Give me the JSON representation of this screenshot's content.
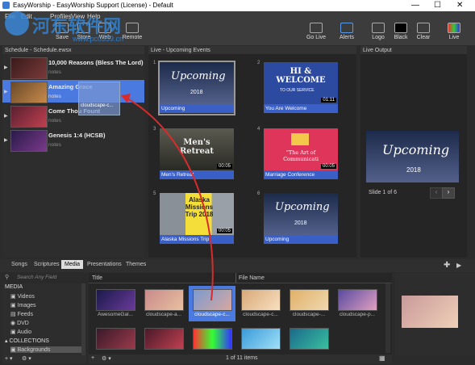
{
  "window": {
    "title": "EasyWorship - EasyWorship Support (License) - Default",
    "min": "—",
    "max": "☐",
    "close": "✕"
  },
  "menu": {
    "file": "File",
    "edit": "Edit",
    "profiles": "Profiles",
    "view": "View",
    "help": "Help"
  },
  "watermark": {
    "site": "www.pc0359.cn",
    "brand": "河东软件网"
  },
  "ribbon": {
    "save": "Save",
    "store": "Store",
    "web": "Web",
    "remote": "Remote",
    "go_live": "Go Live",
    "alerts": "Alerts",
    "logo": "Logo",
    "black": "Black",
    "clear": "Clear",
    "live": "Live"
  },
  "schedule": {
    "header": "Schedule - Schedule.ewsx",
    "items": [
      {
        "title": "10,000 Reasons (Bless The Lord)",
        "note": "notes"
      },
      {
        "title": "Amazing Grace",
        "note": "notes",
        "drag_label": "cloudscape-c..."
      },
      {
        "title": "Come Thou Fount",
        "note": "notes"
      },
      {
        "title": "Genesis 1:4 (HCSB)",
        "note": "notes"
      }
    ]
  },
  "slides": {
    "header": "Live - Upcoming Events",
    "items": [
      {
        "num": "1",
        "caption": "Upcoming",
        "img_title": "Upcoming",
        "img_sub": "2018"
      },
      {
        "num": "2",
        "caption": "You Are Welcome",
        "img_title": "HI & WELCOME",
        "img_sub": "TO OUR SERVICE",
        "dur": "01:11"
      },
      {
        "num": "3",
        "caption": "Men's Retreat",
        "img_title": "Men's Retreat",
        "img_sub": "",
        "dur": "00:05"
      },
      {
        "num": "4",
        "caption": "Marriage Conference",
        "img_title": "\"The Art of Communicati",
        "img_sub": "",
        "dur": "00:05"
      },
      {
        "num": "5",
        "caption": "Alaska Missions Trip",
        "img_title": "Alaska Missions Trip 2018",
        "img_sub": "",
        "dur": "00:05"
      },
      {
        "num": "6",
        "caption": "Upcoming",
        "img_title": "Upcoming",
        "img_sub": "2018"
      }
    ]
  },
  "live_output": {
    "header": "Live Output",
    "title": "Upcoming",
    "sub": "2018",
    "slide_of": "Slide 1 of 6"
  },
  "tabs": {
    "songs": "Songs",
    "scriptures": "Scriptures",
    "media": "Media",
    "presentations": "Presentations",
    "themes": "Themes"
  },
  "media_left": {
    "search_placeholder": "Search Any Field",
    "media_header": "MEDIA",
    "items": [
      "Videos",
      "Images",
      "Feeds",
      "DVD",
      "Audio"
    ],
    "collections_header": "COLLECTIONS",
    "collection_item": "Backgrounds"
  },
  "media_main": {
    "col_title": "Title",
    "col_filename": "File Name",
    "row1": [
      "AwesomeGal...",
      "cloudscape-a...",
      "cloudscape-c...",
      "cloudscape-c...",
      "cloudscape-...",
      "cloudscape-p..."
    ],
    "footer": "1 of 11 items"
  },
  "colors": {
    "accent": "#3a5fc7",
    "selected": "#4a7adf",
    "arrow": "#d92b2b"
  }
}
